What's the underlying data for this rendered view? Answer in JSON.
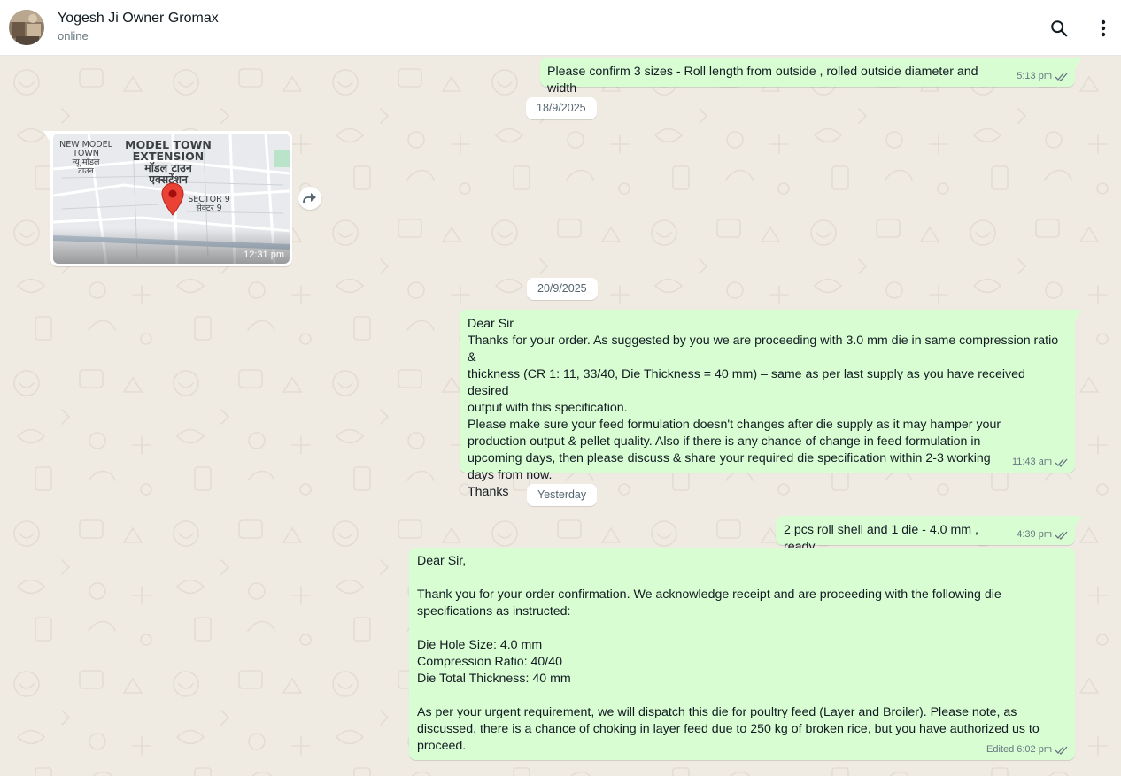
{
  "header": {
    "contact_name": "Yogesh Ji Owner Gromax",
    "status": "online",
    "icons": [
      "search-icon",
      "more-vertical-icon"
    ]
  },
  "colors": {
    "outgoing_bubble": "#d9fdd3",
    "chat_background": "#efeae2",
    "tick_read": "#667781"
  },
  "messages": [
    {
      "text": "Please confirm 3 sizes - Roll length from outside , rolled outside diameter and width",
      "time": "5:13 pm"
    },
    {
      "date": "18/9/2025"
    },
    {
      "location": {
        "labels": {
          "nmt_en1": "NEW MODEL",
          "nmt_en2": "TOWN",
          "nmt_hi1": "न्यू मॉडल",
          "nmt_hi2": "टाउन",
          "mte_en1": "MODEL TOWN",
          "mte_en2": "EXTENSION",
          "mte_hi1": "मॉडल टाउन",
          "mte_hi2": "एक्सटेंशन",
          "sec_en": "SECTOR 9",
          "sec_hi": "सेक्टर 9"
        },
        "time": "12:31 pm"
      }
    },
    {
      "date": "20/9/2025"
    },
    {
      "text": "Dear Sir\nThanks for your order. As suggested by you we are proceeding with 3.0 mm die in same compression ratio &\nthickness (CR 1: 11, 33/40, Die Thickness = 40 mm) – same as per last supply as you have received desired\noutput with this specification.\nPlease make sure your feed formulation doesn't changes after die supply as it may hamper your\nproduction output & pellet quality. Also if there is any chance of change in feed formulation in\nupcoming days, then please discuss & share your required die specification within 2-3 working\ndays from now.\nThanks",
      "time": "11:43 am"
    },
    {
      "date": "Yesterday"
    },
    {
      "text": "2 pcs roll shell and 1 die - 4.0 mm , ready",
      "time": "4:39 pm"
    },
    {
      "text": "Dear Sir,\n\nThank you for your order confirmation. We acknowledge receipt and are proceeding with the following die\nspecifications as instructed:\n\nDie Hole Size: 4.0 mm\nCompression Ratio: 40/40\nDie Total Thickness: 40 mm\n\nAs per your urgent requirement, we will dispatch this die for poultry feed (Layer and Broiler). Please note, as\ndiscussed, there is a chance of choking in layer feed due to 250 kg of broken rice, but you have authorized us to\nproceed.",
      "edited_label": "Edited",
      "time": "6:02 pm"
    }
  ]
}
